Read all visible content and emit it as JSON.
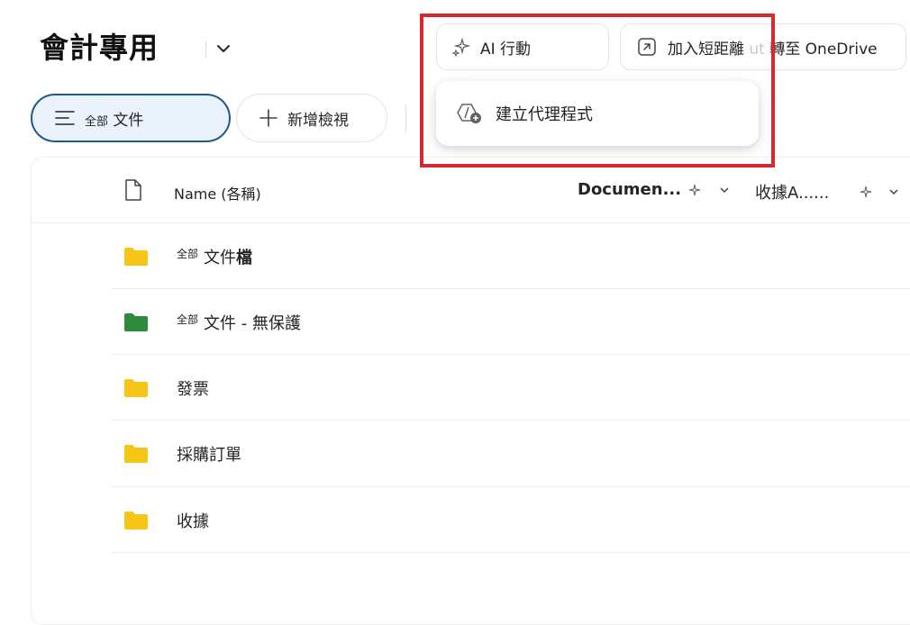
{
  "header": {
    "title": "會計專用",
    "ai_button_label": "AI 行動",
    "shortcut_button_label": "加入短距離",
    "shortcut_ghost": "ut",
    "shortcut_button_suffix": "轉至 OneDrive"
  },
  "popup": {
    "item_label": "建立代理程式"
  },
  "views": {
    "all_prefix": "全部",
    "all_label": "文件",
    "new_view_label": "新增檢視"
  },
  "columns": {
    "name": "Name (各稱)",
    "document": "Documen...",
    "receipt": "收據A......"
  },
  "rows": [
    {
      "prefix": "全部",
      "label": "文件",
      "bold": "檔",
      "color": "#f5c518"
    },
    {
      "prefix": "全部",
      "label": "文件 - 無保護",
      "bold": "",
      "color": "#2e8b3d"
    },
    {
      "prefix": "",
      "label": "發票",
      "bold": "",
      "color": "#f5c518"
    },
    {
      "prefix": "",
      "label": "採購訂單",
      "bold": "",
      "color": "#f5c518"
    },
    {
      "prefix": "",
      "label": "收據",
      "bold": "",
      "color": "#f5c518"
    }
  ],
  "colors": {
    "highlight": "#d42a2f",
    "selected_pill_border": "#1f5a8a",
    "folder_yellow": "#f5c518",
    "folder_green": "#2e8b3d"
  }
}
